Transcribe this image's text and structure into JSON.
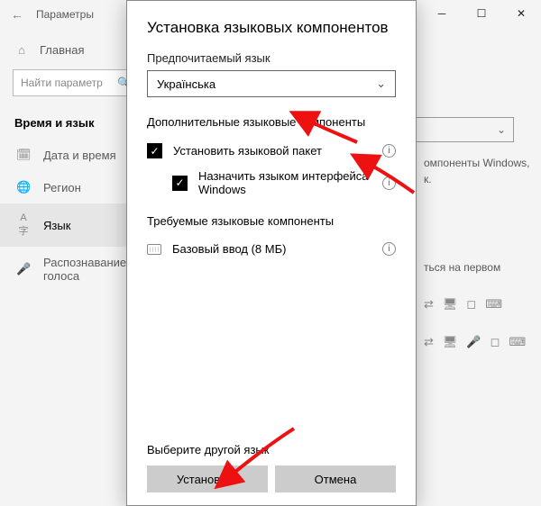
{
  "bg": {
    "title": "Параметры",
    "home": "Главная",
    "search_placeholder": "Найти параметр",
    "category": "Время и язык",
    "items": [
      "Дата и время",
      "Регион",
      "Язык",
      "Распознавание голоса"
    ],
    "right1": "омпоненты Windows,",
    "right2": "к.",
    "right3": "ться на первом"
  },
  "dialog": {
    "title": "Установка языковых компонентов",
    "pref_label": "Предпочитаемый язык",
    "pref_value": "Українська",
    "opt_section": "Дополнительные языковые компоненты",
    "opt1": "Установить языковой пакет",
    "opt2": "Назначить языком интерфейса Windows",
    "req_section": "Требуемые языковые компоненты",
    "req1": "Базовый ввод (8 МБ)",
    "other_lang": "Выберите другой язык",
    "install": "Установить",
    "cancel": "Отмена"
  }
}
